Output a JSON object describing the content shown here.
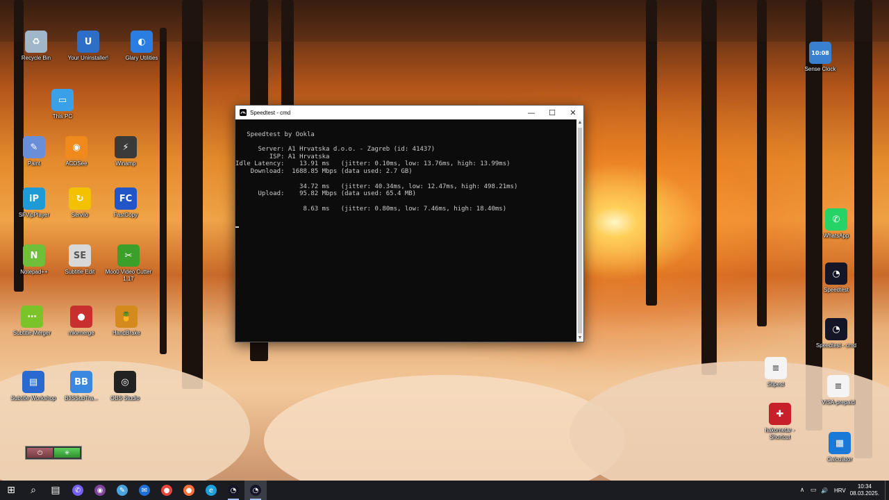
{
  "desktop": {
    "icons_left": [
      {
        "label": "Recycle Bin",
        "glyph": "♻",
        "color": "#9fb7c8"
      },
      {
        "label": "Your Uninstaller!",
        "glyph": "U",
        "color": "#2d6fc8"
      },
      {
        "label": "Glary Utilities",
        "glyph": "◐",
        "color": "#2a7de1"
      },
      {
        "label": "This PC",
        "glyph": "▭",
        "color": "#3aa0e8"
      },
      {
        "label": "Paint",
        "glyph": "✎",
        "color": "#6a8fd8"
      },
      {
        "label": "ACDSee",
        "glyph": "◉",
        "color": "#f08a1c"
      },
      {
        "label": "Winamp",
        "glyph": "⚡",
        "color": "#3a3a3a"
      },
      {
        "label": "SFVipPlayer",
        "glyph": "iP",
        "color": "#1e9ad6"
      },
      {
        "label": "Serviio",
        "glyph": "↻",
        "color": "#f2c100"
      },
      {
        "label": "FastCopy",
        "glyph": "FC",
        "color": "#2255c8"
      },
      {
        "label": "Notepad++",
        "glyph": "N",
        "color": "#6fbf3a"
      },
      {
        "label": "Subtitle Edit",
        "glyph": "SE",
        "color": "#d8d8d8"
      },
      {
        "label": "Moo0 Video Cutter 1.17",
        "glyph": "✂",
        "color": "#3aa02a"
      },
      {
        "label": "Subtitle Merger",
        "glyph": "⋯",
        "color": "#7ac42a"
      },
      {
        "label": "mkvmerge",
        "glyph": "●",
        "color": "#c83030"
      },
      {
        "label": "HandBrake",
        "glyph": "🍍",
        "color": "#d48a1c"
      },
      {
        "label": "Subtitle Workshop",
        "glyph": "▤",
        "color": "#2a6ad0"
      },
      {
        "label": "B3SSubTra...",
        "glyph": "BB",
        "color": "#3a88e0"
      },
      {
        "label": "OBS Studio",
        "glyph": "◎",
        "color": "#222222"
      }
    ],
    "icons_right": [
      {
        "label": "Sense Clock",
        "glyph": "10:08",
        "color": "#3a80d0"
      },
      {
        "label": "WhatsApp",
        "glyph": "✆",
        "color": "#25d366"
      },
      {
        "label": "Speedtest",
        "glyph": "◔",
        "color": "#141526"
      },
      {
        "label": "Speedtest - cmd",
        "glyph": "◔",
        "color": "#141526"
      },
      {
        "label": "Stipest",
        "glyph": "≡",
        "color": "#f4f4f4"
      },
      {
        "label": "VISA-prepaid",
        "glyph": "≡",
        "color": "#f4f4f4"
      },
      {
        "label": "hakometar - Shortcut",
        "glyph": "✚",
        "color": "#c8202a"
      },
      {
        "label": "Calculator",
        "glyph": "▦",
        "color": "#1a78d6"
      }
    ]
  },
  "cmd_window": {
    "title": "Speedtest - cmd",
    "controls": {
      "minimize": "—",
      "maximize": "☐",
      "close": "✕"
    },
    "lines": [
      "",
      "   Speedtest by Ookla",
      "",
      "      Server: A1 Hrvatska d.o.o. - Zagreb (id: 41437)",
      "         ISP: A1 Hrvatska",
      "Idle Latency:    13.91 ms   (jitter: 0.10ms, low: 13.76ms, high: 13.99ms)",
      "    Download:  1688.85 Mbps (data used: 2.7 GB)",
      "",
      "                 34.72 ms   (jitter: 40.34ms, low: 12.47ms, high: 498.21ms)",
      "      Upload:    95.82 Mbps (data used: 65.4 MB)",
      "",
      "                  8.63 ms   (jitter: 0.80ms, low: 7.46ms, high: 18.40ms)",
      ""
    ]
  },
  "taskbar": {
    "apps": [
      {
        "name": "start",
        "glyph": "⊞",
        "color": "transparent"
      },
      {
        "name": "search",
        "glyph": "⌕",
        "color": "transparent"
      },
      {
        "name": "task-manager",
        "glyph": "▤",
        "color": "transparent"
      },
      {
        "name": "viber",
        "glyph": "✆",
        "color": "#7360f2"
      },
      {
        "name": "tor",
        "glyph": "◉",
        "color": "#7d4698"
      },
      {
        "name": "notepad",
        "glyph": "✎",
        "color": "#4aa3df"
      },
      {
        "name": "thunderbird",
        "glyph": "✉",
        "color": "#1f6fd6"
      },
      {
        "name": "chrome",
        "glyph": "●",
        "color": "#e8453c"
      },
      {
        "name": "firefox",
        "glyph": "●",
        "color": "#ff7139"
      },
      {
        "name": "edge",
        "glyph": "e",
        "color": "#1f9fd8"
      },
      {
        "name": "speedtest",
        "glyph": "◔",
        "color": "#141526"
      },
      {
        "name": "speedtest-cmd",
        "glyph": "◔",
        "color": "#141526"
      }
    ],
    "tray": {
      "chevron": "∧",
      "network": "▭",
      "volume": "🔊",
      "language": "HRV",
      "time": "10:34",
      "date": "08.03.2025."
    }
  }
}
